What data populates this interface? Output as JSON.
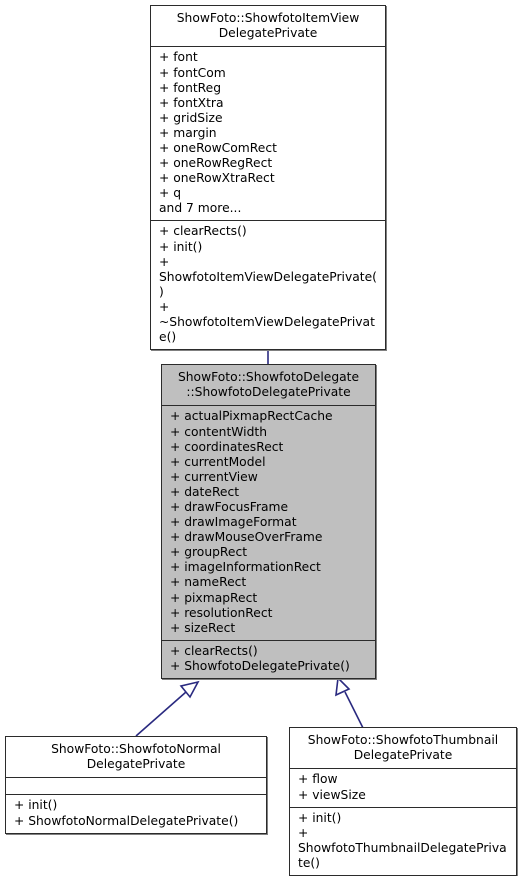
{
  "diagram": {
    "kind": "uml-class-inheritance-diagram",
    "edge_color": "#2a2a80",
    "fill_color_highlight": "#bfbfbf",
    "fill_color_default": "#ffffff",
    "border_color": "#2b2b2b",
    "classes": [
      {
        "id": "itemview-delegate-private",
        "name": "ShowFoto::ShowfotoItemView\nDelegatePrivate",
        "highlighted": false,
        "attributes": [
          "+ font",
          "+ fontCom",
          "+ fontReg",
          "+ fontXtra",
          "+ gridSize",
          "+ margin",
          "+ oneRowComRect",
          "+ oneRowRegRect",
          "+ oneRowXtraRect",
          "+ q",
          "and 7 more..."
        ],
        "operations": [
          "+ clearRects()",
          "+ init()",
          "+ ShowfotoItemViewDelegatePrivate()",
          "+ ~ShowfotoItemViewDelegatePrivate()"
        ]
      },
      {
        "id": "showfoto-delegate-private",
        "name": "ShowFoto::ShowfotoDelegate\n::ShowfotoDelegatePrivate",
        "highlighted": true,
        "attributes": [
          "+ actualPixmapRectCache",
          "+ contentWidth",
          "+ coordinatesRect",
          "+ currentModel",
          "+ currentView",
          "+ dateRect",
          "+ drawFocusFrame",
          "+ drawImageFormat",
          "+ drawMouseOverFrame",
          "+ groupRect",
          "+ imageInformationRect",
          "+ nameRect",
          "+ pixmapRect",
          "+ resolutionRect",
          "+ sizeRect"
        ],
        "operations": [
          "+ clearRects()",
          "+ ShowfotoDelegatePrivate()"
        ]
      },
      {
        "id": "normal-delegate-private",
        "name": "ShowFoto::ShowfotoNormal\nDelegatePrivate",
        "highlighted": false,
        "attributes": [],
        "operations": [
          "+ init()",
          "+ ShowfotoNormalDelegatePrivate()"
        ]
      },
      {
        "id": "thumbnail-delegate-private",
        "name": "ShowFoto::ShowfotoThumbnail\nDelegatePrivate",
        "highlighted": false,
        "attributes": [
          "+ flow",
          "+ viewSize"
        ],
        "operations": [
          "+ init()",
          "+ ShowfotoThumbnailDelegatePrivate()"
        ]
      }
    ],
    "inheritance_edges": [
      {
        "from": "showfoto-delegate-private",
        "to": "itemview-delegate-private"
      },
      {
        "from": "normal-delegate-private",
        "to": "showfoto-delegate-private"
      },
      {
        "from": "thumbnail-delegate-private",
        "to": "showfoto-delegate-private"
      }
    ]
  }
}
